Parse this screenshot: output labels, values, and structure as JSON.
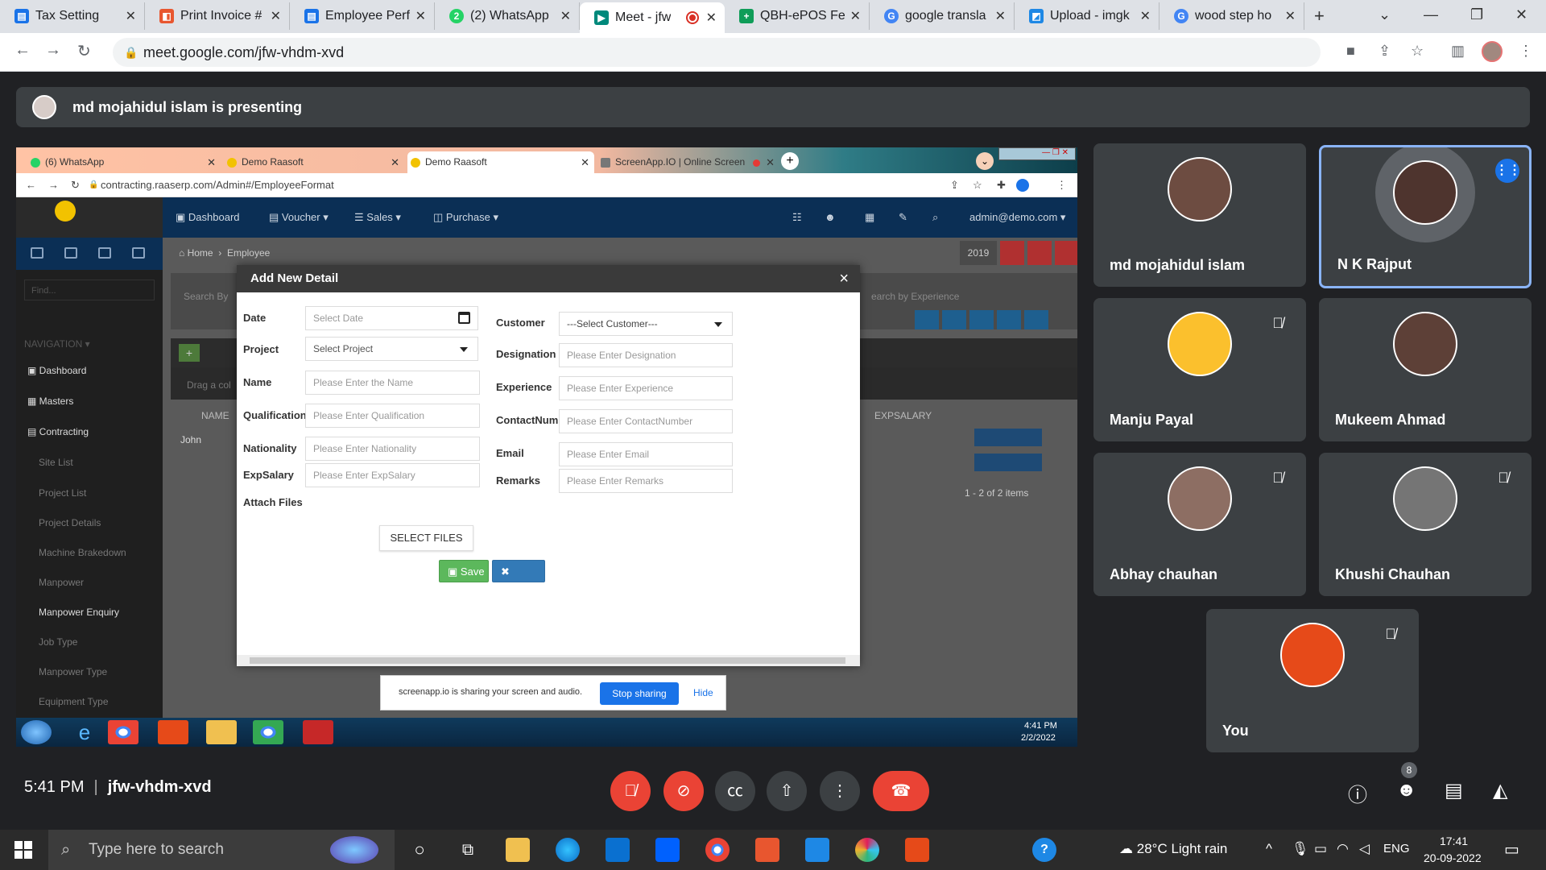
{
  "browser": {
    "tabs": [
      {
        "label": "Tax Setting",
        "color": "#1a73e8",
        "glyph": "▤"
      },
      {
        "label": "Print Invoice #",
        "color": "#e8562f",
        "glyph": "◧"
      },
      {
        "label": "Employee Perf",
        "color": "#1a73e8",
        "glyph": "▤"
      },
      {
        "label": "(2) WhatsApp",
        "color": "#25d366",
        "glyph": "2"
      },
      {
        "label": "Meet - jfw",
        "color": "#00897b",
        "glyph": "▶"
      },
      {
        "label": "QBH-ePOS Fe",
        "color": "#0f9d58",
        "glyph": "+"
      },
      {
        "label": "google transla",
        "color": "#4285f4",
        "glyph": "G"
      },
      {
        "label": "Upload - imgk",
        "color": "#1e88e5",
        "glyph": "◩"
      },
      {
        "label": "wood step ho",
        "color": "#4285f4",
        "glyph": "G"
      }
    ],
    "url": "meet.google.com/jfw-vhdm-xvd"
  },
  "meet": {
    "presenting_banner": "md mojahidul islam is presenting",
    "time": "5:41 PM",
    "meeting_code": "jfw-vhdm-xvd",
    "participant_count": "8",
    "participants": [
      {
        "name": "md mojahidul islam",
        "muted": false
      },
      {
        "name": "N K Rajput",
        "muted": false,
        "speaking": true
      },
      {
        "name": "Manju Payal",
        "muted": true
      },
      {
        "name": "Mukeem Ahmad",
        "muted": false
      },
      {
        "name": "Abhay chauhan",
        "muted": true
      },
      {
        "name": "Khushi Chauhan",
        "muted": true
      },
      {
        "name": "You",
        "muted": true
      }
    ]
  },
  "shared_screen": {
    "tabs": [
      {
        "label": "(6) WhatsApp"
      },
      {
        "label": "Demo Raasoft"
      },
      {
        "label": "Demo Raasoft"
      },
      {
        "label": "ScreenApp.IO | Online Screen"
      }
    ],
    "url": "contracting.raaserp.com/Admin#/EmployeeFormat",
    "nav": {
      "dashboard": "Dashboard",
      "voucher": "Voucher ▾",
      "sales": "Sales ▾",
      "purchase": "Purchase ▾",
      "user": "admin@demo.com ▾"
    },
    "sidebar": {
      "find": "Find...",
      "nav_header": "NAVIGATION ▾",
      "items": [
        {
          "label": "Dashboard"
        },
        {
          "label": "Masters"
        },
        {
          "label": "Contracting"
        },
        {
          "label": "Site List"
        },
        {
          "label": "Project List"
        },
        {
          "label": "Project Details"
        },
        {
          "label": "Machine Brakedown"
        },
        {
          "label": "Manpower"
        },
        {
          "label": "Manpower Enquiry"
        },
        {
          "label": "Job Type"
        },
        {
          "label": "Manpower Type"
        },
        {
          "label": "Equipment Type"
        }
      ]
    },
    "breadcrumb": {
      "home": "Home",
      "current": "Employee"
    },
    "year": "2019",
    "search_by": "Search By",
    "search_experience": "earch by Experience",
    "drag_hint": "Drag a col",
    "col_name": "NAME",
    "col_expsalary": "EXPSALARY",
    "row_name": "John",
    "pager": "1 - 2 of 2 items",
    "modal": {
      "title": "Add New Detail",
      "close": "×",
      "fields": {
        "date": {
          "label": "Date",
          "placeholder": "Select Date"
        },
        "project": {
          "label": "Project",
          "placeholder": "Select Project"
        },
        "name": {
          "label": "Name",
          "placeholder": "Please Enter the Name"
        },
        "qualification": {
          "label": "Qualification",
          "placeholder": "Please Enter Qualification"
        },
        "nationality": {
          "label": "Nationality",
          "placeholder": "Please Enter Nationality"
        },
        "expsalary": {
          "label": "ExpSalary",
          "placeholder": "Please Enter ExpSalary"
        },
        "attach": {
          "label": "Attach Files"
        },
        "customer": {
          "label": "Customer",
          "placeholder": "---Select Customer---"
        },
        "designation": {
          "label": "Designation",
          "placeholder": "Please Enter Designation"
        },
        "experience": {
          "label": "Experience",
          "placeholder": "Please Enter Experience"
        },
        "contact": {
          "label": "ContactNumber",
          "placeholder": "Please Enter ContactNumber"
        },
        "email": {
          "label": "Email",
          "placeholder": "Please Enter Email"
        },
        "remarks": {
          "label": "Remarks",
          "placeholder": "Please Enter Remarks"
        }
      },
      "select_files": "SELECT FILES",
      "save": "Save",
      "cancel": "Cancel"
    },
    "share_bar": {
      "text": "screenapp.io is sharing your screen and audio.",
      "stop": "Stop sharing",
      "hide": "Hide"
    },
    "taskbar": {
      "time": "4:41 PM",
      "date": "2/2/2022"
    }
  },
  "windows": {
    "search_placeholder": "Type here to search",
    "weather": "28°C  Light rain",
    "lang": "ENG",
    "time": "17:41",
    "date": "20-09-2022"
  }
}
